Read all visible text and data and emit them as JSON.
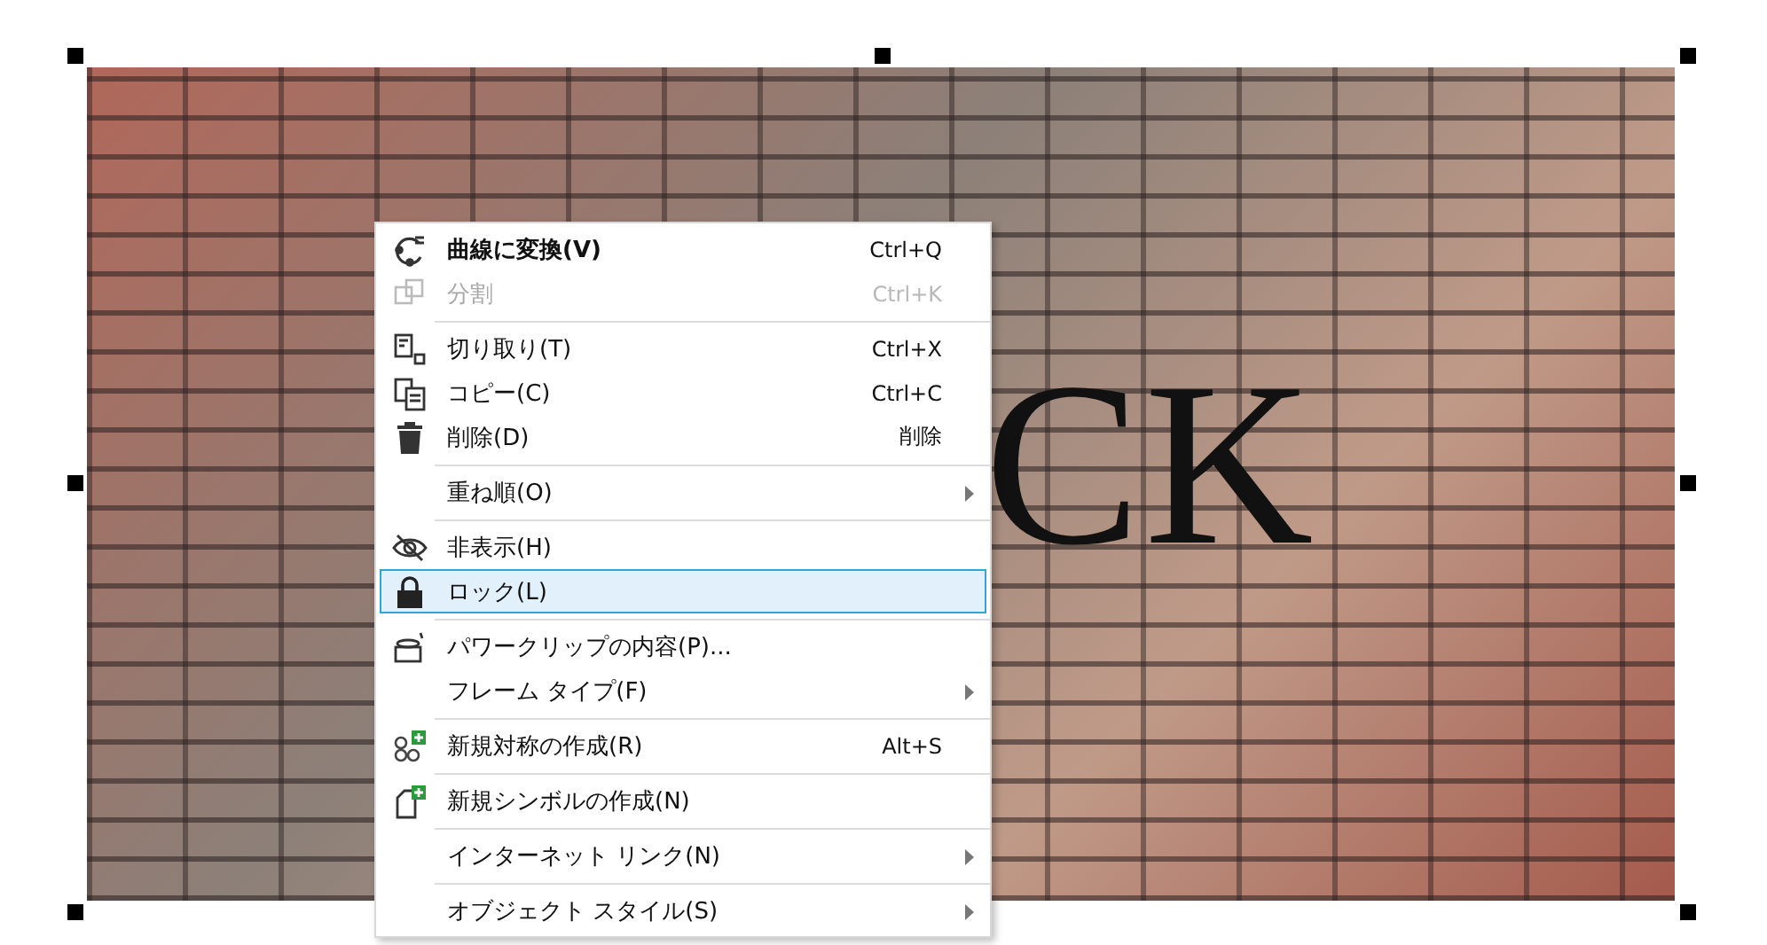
{
  "canvas": {
    "text_object": "CK"
  },
  "context_menu": {
    "items": [
      {
        "kind": "item",
        "label": "曲線に変換(V)",
        "shortcut": "Ctrl+Q",
        "bold": true,
        "disabled": false,
        "selected": false,
        "submenu": false
      },
      {
        "kind": "item",
        "label": "分割",
        "shortcut": "Ctrl+K",
        "bold": false,
        "disabled": true,
        "selected": false,
        "submenu": false
      },
      {
        "kind": "separator"
      },
      {
        "kind": "item",
        "label": "切り取り(T)",
        "shortcut": "Ctrl+X",
        "bold": false,
        "disabled": false,
        "selected": false,
        "submenu": false
      },
      {
        "kind": "item",
        "label": "コピー(C)",
        "shortcut": "Ctrl+C",
        "bold": false,
        "disabled": false,
        "selected": false,
        "submenu": false
      },
      {
        "kind": "item",
        "label": "削除(D)",
        "shortcut": "削除",
        "bold": false,
        "disabled": false,
        "selected": false,
        "submenu": false
      },
      {
        "kind": "separator"
      },
      {
        "kind": "item",
        "label": "重ね順(O)",
        "bold": false,
        "disabled": false,
        "selected": false,
        "submenu": true
      },
      {
        "kind": "separator"
      },
      {
        "kind": "item",
        "label": "非表示(H)",
        "bold": false,
        "disabled": false,
        "selected": false,
        "submenu": false
      },
      {
        "kind": "item",
        "label": "ロック(L)",
        "bold": false,
        "disabled": false,
        "selected": true,
        "submenu": false
      },
      {
        "kind": "separator"
      },
      {
        "kind": "item",
        "label": "パワークリップの内容(P)...",
        "bold": false,
        "disabled": false,
        "selected": false,
        "submenu": false
      },
      {
        "kind": "item",
        "label": "フレーム タイプ(F)",
        "bold": false,
        "disabled": false,
        "selected": false,
        "submenu": true
      },
      {
        "kind": "separator"
      },
      {
        "kind": "item",
        "label": "新規対称の作成(R)",
        "shortcut": "Alt+S",
        "bold": false,
        "disabled": false,
        "selected": false,
        "submenu": false
      },
      {
        "kind": "separator"
      },
      {
        "kind": "item",
        "label": "新規シンボルの作成(N)",
        "bold": false,
        "disabled": false,
        "selected": false,
        "submenu": false
      },
      {
        "kind": "separator"
      },
      {
        "kind": "item",
        "label": "インターネット リンク(N)",
        "bold": false,
        "disabled": false,
        "selected": false,
        "submenu": true
      },
      {
        "kind": "separator"
      },
      {
        "kind": "item",
        "label": "オブジェクト スタイル(S)",
        "bold": false,
        "disabled": false,
        "selected": false,
        "submenu": true
      }
    ]
  }
}
